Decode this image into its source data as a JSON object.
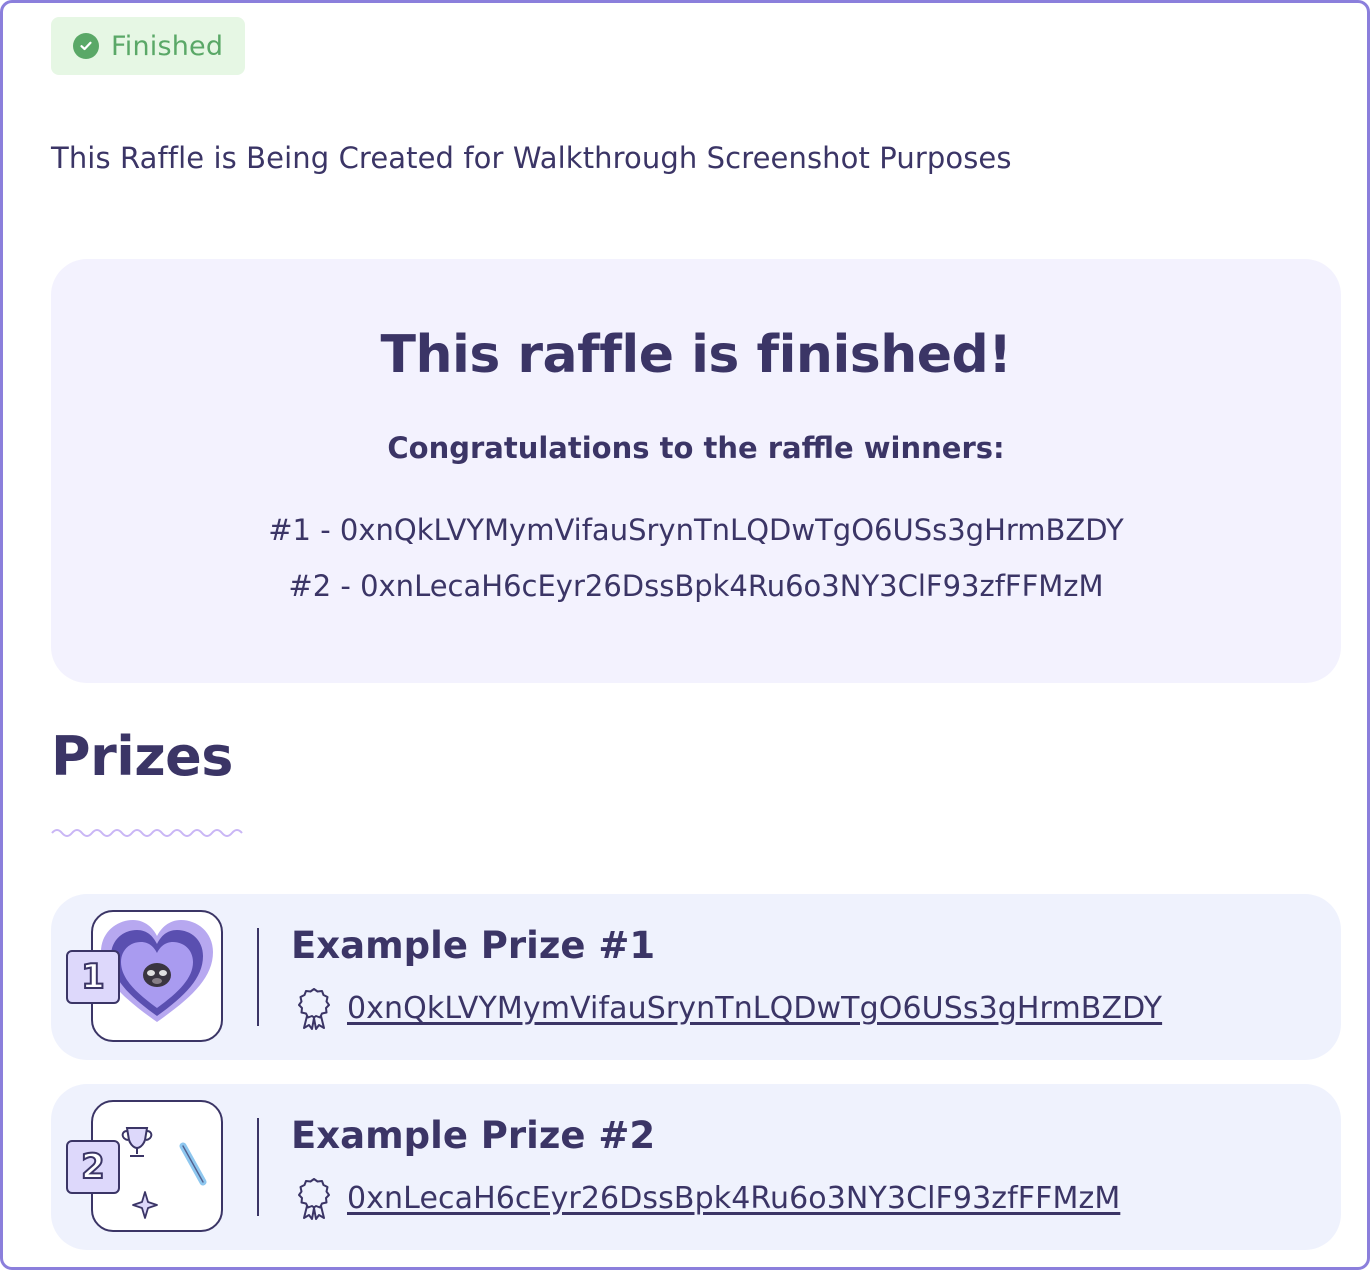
{
  "status": {
    "label": "Finished",
    "color": "#5aa867",
    "icon": "check-circle-icon"
  },
  "raffle": {
    "title": "This Raffle is Being Created for Walkthrough Screenshot Purposes"
  },
  "result": {
    "heading": "This raffle is finished!",
    "congrats": "Congratulations to the raffle winners:",
    "winners": [
      "#1 - 0xnQkLVYMymVifauSrynTnLQDwTgO6USs3gHrmBZDY",
      "#2 - 0xnLecaH6cEyr26DssBpk4Ru6o3NY3ClF93zfFFMzM"
    ]
  },
  "prizes": {
    "heading": "Prizes",
    "items": [
      {
        "rank": "1",
        "name": "Example Prize #1",
        "winner": "0xnQkLVYMymVifauSrynTnLQDwTgO6USs3gHrmBZDY",
        "image_icon": "heart-icon"
      },
      {
        "rank": "2",
        "name": "Example Prize #2",
        "winner": "0xnLecaH6cEyr26DssBpk4Ru6o3NY3ClF93zfFFMzM",
        "image_icon": "trophy-icon"
      }
    ]
  },
  "colors": {
    "text": "#3b3566",
    "accent": "#8b7fdc",
    "panel": "#f3f2fe",
    "card": "#eff2fd",
    "badge_bg": "#e6f7e4"
  }
}
